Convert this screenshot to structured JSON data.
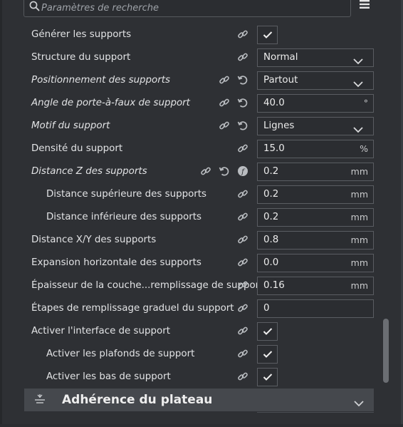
{
  "search": {
    "placeholder": "Paramètres de recherche"
  },
  "settings": [
    {
      "label": "Générer les supports",
      "type": "checkbox",
      "checked": true,
      "italic": false,
      "indent": false,
      "icons": [
        "link"
      ]
    },
    {
      "label": "Structure du support",
      "type": "select",
      "value": "Normal",
      "italic": false,
      "indent": false,
      "icons": [
        "link"
      ]
    },
    {
      "label": "Positionnement des supports",
      "type": "select",
      "value": "Partout",
      "italic": true,
      "indent": false,
      "icons": [
        "link",
        "reset"
      ]
    },
    {
      "label": "Angle de porte-à-faux de support",
      "type": "number",
      "value": "40.0",
      "unit": "°",
      "italic": true,
      "indent": false,
      "icons": [
        "link",
        "reset"
      ]
    },
    {
      "label": "Motif du support",
      "type": "select",
      "value": "Lignes",
      "italic": true,
      "indent": false,
      "icons": [
        "link",
        "reset"
      ]
    },
    {
      "label": "Densité du support",
      "type": "number",
      "value": "15.0",
      "unit": "%",
      "italic": false,
      "indent": false,
      "icons": [
        "link"
      ]
    },
    {
      "label": "Distance Z des supports",
      "type": "number",
      "value": "0.2",
      "unit": "mm",
      "italic": true,
      "indent": false,
      "icons": [
        "link",
        "reset",
        "function"
      ]
    },
    {
      "label": "Distance supérieure des supports",
      "type": "number",
      "value": "0.2",
      "unit": "mm",
      "italic": false,
      "indent": true,
      "icons": [
        "link"
      ]
    },
    {
      "label": "Distance inférieure des supports",
      "type": "number",
      "value": "0.2",
      "unit": "mm",
      "italic": false,
      "indent": true,
      "icons": [
        "link"
      ]
    },
    {
      "label": "Distance X/Y des supports",
      "type": "number",
      "value": "0.8",
      "unit": "mm",
      "italic": false,
      "indent": false,
      "icons": [
        "link"
      ]
    },
    {
      "label": "Expansion horizontale des supports",
      "type": "number",
      "value": "0.0",
      "unit": "mm",
      "italic": false,
      "indent": false,
      "icons": [
        "link"
      ]
    },
    {
      "label": "Épaisseur de la couche...remplissage de support",
      "type": "number",
      "value": "0.16",
      "unit": "mm",
      "italic": false,
      "indent": false,
      "icons": [
        "link"
      ]
    },
    {
      "label": "Étapes de remplissage graduel du support",
      "type": "number",
      "value": "0",
      "unit": "",
      "italic": false,
      "indent": false,
      "icons": [
        "link"
      ]
    },
    {
      "label": "Activer l'interface de support",
      "type": "checkbox",
      "checked": true,
      "italic": false,
      "indent": false,
      "icons": [
        "link"
      ]
    },
    {
      "label": "Activer les plafonds de support",
      "type": "checkbox",
      "checked": true,
      "italic": false,
      "indent": true,
      "icons": [
        "link"
      ]
    },
    {
      "label": "Activer les bas de support",
      "type": "checkbox",
      "checked": true,
      "italic": false,
      "indent": true,
      "icons": [
        "link"
      ]
    }
  ],
  "section": {
    "title": "Adhérence du plateau",
    "icon": "bed-adhesion-icon"
  },
  "colors": {
    "background": "#2e3034",
    "field_border": "#5a5d62",
    "section_bg": "#45484d",
    "text": "#e2e3e5"
  }
}
